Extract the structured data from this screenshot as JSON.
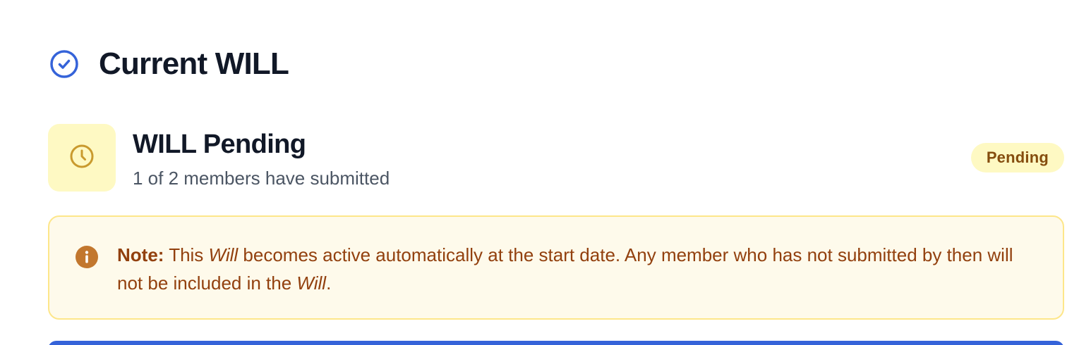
{
  "header": {
    "icon": "check-circle-icon",
    "title": "Current WILL"
  },
  "status": {
    "icon": "clock-icon",
    "title": "WILL Pending",
    "subtitle": "1 of 2 members have submitted",
    "badge": "Pending"
  },
  "note": {
    "icon": "info-icon",
    "label": "Note:",
    "part1": " This ",
    "will_word_1": "Will",
    "part2": " becomes active automatically at the start date. Any member who has not submitted by then will not be included in the ",
    "will_word_2": "Will",
    "part3": "."
  },
  "colors": {
    "accent_blue": "#3563d9",
    "pending_bg": "#fef9c3",
    "pending_text": "#854d0e",
    "note_text": "#92400e",
    "note_icon": "#c2772e"
  }
}
